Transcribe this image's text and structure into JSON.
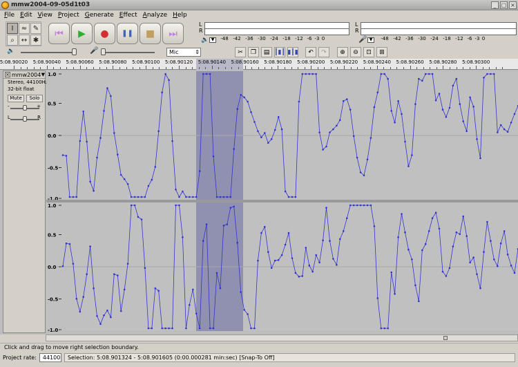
{
  "window": {
    "title": "mmw2004-09-05d1t03"
  },
  "menu": [
    "File",
    "Edit",
    "View",
    "Project",
    "Generate",
    "Effect",
    "Analyze",
    "Help"
  ],
  "tools": [
    {
      "name": "selection-tool",
      "glyph": "I",
      "active": true
    },
    {
      "name": "envelope-tool",
      "glyph": "≈",
      "active": false
    },
    {
      "name": "draw-tool",
      "glyph": "✎",
      "active": false
    },
    {
      "name": "zoom-tool",
      "glyph": "⌕",
      "active": false
    },
    {
      "name": "timeshift-tool",
      "glyph": "↔",
      "active": false
    },
    {
      "name": "multi-tool",
      "glyph": "✱",
      "active": false
    }
  ],
  "transport": [
    {
      "name": "skip-start-button",
      "glyph": "⏮",
      "color": "#c080e0"
    },
    {
      "name": "play-button",
      "glyph": "▶",
      "color": "#30b030"
    },
    {
      "name": "record-button",
      "glyph": "●",
      "color": "#d03030"
    },
    {
      "name": "pause-button",
      "glyph": "❚❚",
      "color": "#4060d0"
    },
    {
      "name": "stop-button",
      "glyph": "■",
      "color": "#c0a060"
    },
    {
      "name": "skip-end-button",
      "glyph": "⏭",
      "color": "#c080e0"
    }
  ],
  "meters": {
    "left_letter": "L",
    "right_letter": "R",
    "ticks": [
      "-48",
      "-42",
      "-36",
      "-30",
      "-24",
      "-18",
      "-12",
      "-6",
      "-3",
      "0"
    ]
  },
  "mixer": {
    "input_source": "Mic"
  },
  "ruler": {
    "labels": [
      "5:08.90020",
      "5:08.90040",
      "5:08.90060",
      "5:08.90080",
      "5:08.90100",
      "5:08.90120",
      "5:08.90140",
      "5:08.90160",
      "5:08.90180",
      "5:08.90200",
      "5:08.90220",
      "5:08.90240",
      "5:08.90260",
      "5:08.90280",
      "5:08.90300"
    ]
  },
  "track": {
    "name": "mmw2004-0",
    "format": "Stereo, 44100Hz",
    "bit_depth": "32-bit float",
    "mute_label": "Mute",
    "solo_label": "Solo",
    "gain_minus": "-",
    "gain_plus": "+",
    "pan_left": "L",
    "pan_right": "R",
    "scale": [
      "1.0",
      "0.5",
      "0.0",
      "-0.5",
      "-1.0"
    ],
    "wave_color": "#3333cc",
    "selection_color": "#9090b0",
    "left_channel": [
      -0.32,
      -0.33,
      -1,
      -1,
      -1,
      -0.09,
      0.39,
      -0.1,
      -0.75,
      -0.9,
      -0.36,
      -0.04,
      0.4,
      0.77,
      0.64,
      0.04,
      -0.31,
      -0.64,
      -0.71,
      -0.79,
      -1,
      -1,
      -1,
      -1,
      -1,
      -0.82,
      -0.72,
      -0.51,
      0.07,
      0.7,
      1,
      0.9,
      -0.09,
      -0.88,
      -1,
      -0.91,
      -1,
      -1,
      -1,
      -1,
      -0.58,
      1,
      1,
      1,
      -0.34,
      -1,
      -1,
      -1,
      -1,
      -1,
      -0.22,
      0.43,
      0.66,
      0.62,
      0.55,
      0.38,
      0.22,
      0.07,
      -0.03,
      0.04,
      -0.12,
      -0.06,
      0.09,
      0.3,
      0.1,
      -0.91,
      -1,
      -1,
      -1,
      0.55,
      1,
      1,
      1,
      1,
      1,
      0.05,
      -0.23,
      -0.18,
      0.05,
      0.1,
      0.16,
      0.25,
      0.56,
      0.59,
      0.42,
      -0.01,
      -0.36,
      -0.6,
      -0.65,
      -0.39,
      -0.04,
      0.46,
      0.7,
      1,
      1,
      0.92,
      0.4,
      0.21,
      0.56,
      0.35,
      -0.1,
      -0.5,
      -0.32,
      0.51,
      0.92,
      0.89,
      1,
      1,
      1,
      0.57,
      0.68,
      0.42,
      0.3,
      0.45,
      0.81,
      0.92,
      0.51,
      0.23,
      0.07,
      0.62,
      0.47,
      -0.06,
      -0.37,
      0.94,
      1,
      1,
      1,
      0.05,
      0.17,
      0.1,
      0.06,
      0.21,
      0.35,
      0.48
    ],
    "right_channel": [
      0.01,
      0.38,
      0.37,
      0.05,
      -0.52,
      -0.73,
      -0.49,
      -0.12,
      0.33,
      -0.35,
      -0.8,
      -0.93,
      -0.79,
      -0.71,
      -0.82,
      -0.12,
      -0.14,
      -0.72,
      -0.37,
      0.05,
      1,
      1,
      0.81,
      0.77,
      -0.02,
      -1,
      -1,
      -0.35,
      -0.39,
      -1,
      -1,
      -1,
      -1,
      1,
      1,
      0.48,
      -1,
      -0.62,
      -0.37,
      -0.76,
      -1,
      0.42,
      0.69,
      -1,
      -1,
      -0.1,
      -0.35,
      0.67,
      0.69,
      0.96,
      0.98,
      0.39,
      -0.41,
      -0.7,
      -0.77,
      -1,
      -1,
      0.1,
      0.55,
      0.65,
      0.24,
      -0.02,
      0.1,
      0.11,
      0.19,
      0.36,
      0.55,
      0.14,
      -0.1,
      -0.16,
      -0.15,
      0.31,
      0.02,
      -0.08,
      0.19,
      0.07,
      0.43,
      0.96,
      0.42,
      0.13,
      0.03,
      0.45,
      0.58,
      0.79,
      1,
      1,
      1,
      1,
      1,
      1,
      1,
      0.66,
      -0.51,
      -1,
      -1,
      -1,
      -0.09,
      -0.44,
      0.48,
      0.86,
      0.56,
      0.28,
      0.12,
      -0.3,
      -0.56,
      0.27,
      0.37,
      0.58,
      0.79,
      0.88,
      0.62,
      -0.08,
      -0.15,
      -0.02,
      0.33,
      0.56,
      0.53,
      0.82,
      0.5,
      0.07,
      0.15,
      -0.12,
      -0.35,
      0.24,
      0.73,
      0.42,
      0.12,
      0.01,
      0.38,
      0.58,
      0.2,
      0.02,
      -0.1,
      0.29
    ]
  },
  "status": {
    "message": "Click and drag to move right selection boundary.",
    "rate_label": "Project rate:",
    "rate_value": "44100",
    "selection_text": "Selection: 5:08.901324 - 5:08.901605 (0:00.000281 min:sec)  [Snap-To Off]"
  }
}
